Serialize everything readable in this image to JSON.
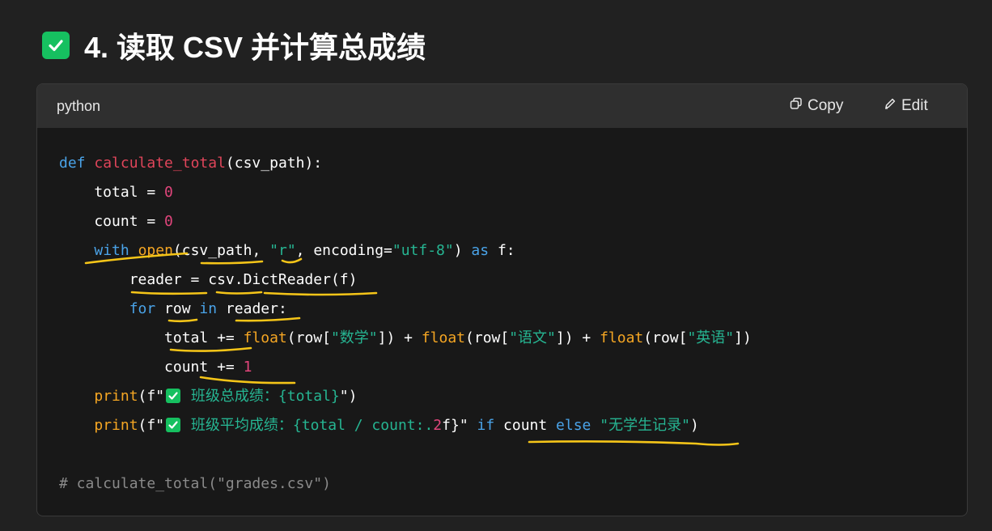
{
  "heading": {
    "title": "4. 读取 CSV 并计算总成绩"
  },
  "codeblock": {
    "language": "python",
    "copy_label": "Copy",
    "edit_label": "Edit",
    "code": {
      "l1_def": "def",
      "l1_fname": "calculate_total",
      "l1_rest": "(csv_path):",
      "l2_var": "    total = ",
      "l2_num": "0",
      "l3_var": "    count = ",
      "l3_num": "0",
      "l4_with": "with",
      "l4_open": "open",
      "l4_args": "(csv_path, ",
      "l4_mode": "\"r\"",
      "l4_enc": ", encoding=",
      "l4_encval": "\"utf-8\"",
      "l4_close": ") ",
      "l4_as": "as",
      "l4_f": " f:",
      "l5": "        reader = csv.DictReader(f)",
      "l6_for": "for",
      "l6_row": " row ",
      "l6_in": "in",
      "l6_reader": " reader:",
      "l7_lhs": "            total += ",
      "l7_float1": "float",
      "l7_a1": "(row[",
      "l7_s1": "\"数学\"",
      "l7_a2": "]) + ",
      "l7_float2": "float",
      "l7_a3": "(row[",
      "l7_s2": "\"语文\"",
      "l7_a4": "]) + ",
      "l7_float3": "float",
      "l7_a5": "(row[",
      "l7_s3": "\"英语\"",
      "l7_a6": "])",
      "l8_lhs": "            count += ",
      "l8_num": "1",
      "l9_print": "print",
      "l9_open": "(f\"",
      "l9_str": " 班级总成绩：{total}",
      "l9_close": "\")",
      "l10_print": "print",
      "l10_open": "(f\"",
      "l10_str": " 班级平均成绩：{total / count:.",
      "l10_num": "2",
      "l10_f": "f}\" ",
      "l10_if": "if",
      "l10_count": " count ",
      "l10_else": "else",
      "l10_sp": " ",
      "l10_str2": "\"无学生记录\"",
      "l10_close": ")",
      "l12_comment": "# calculate_total(\"grades.csv\")"
    }
  },
  "colors": {
    "keyword": "#4aa3e8",
    "function_name": "#e0455a",
    "builtin": "#f5a623",
    "number": "#e0457b",
    "string": "#26b592",
    "comment": "#8a8a8a",
    "check_green": "#16c060",
    "annotation": "#f5c518"
  },
  "icons": [
    "check-box-icon",
    "copy-icon",
    "edit-icon"
  ]
}
